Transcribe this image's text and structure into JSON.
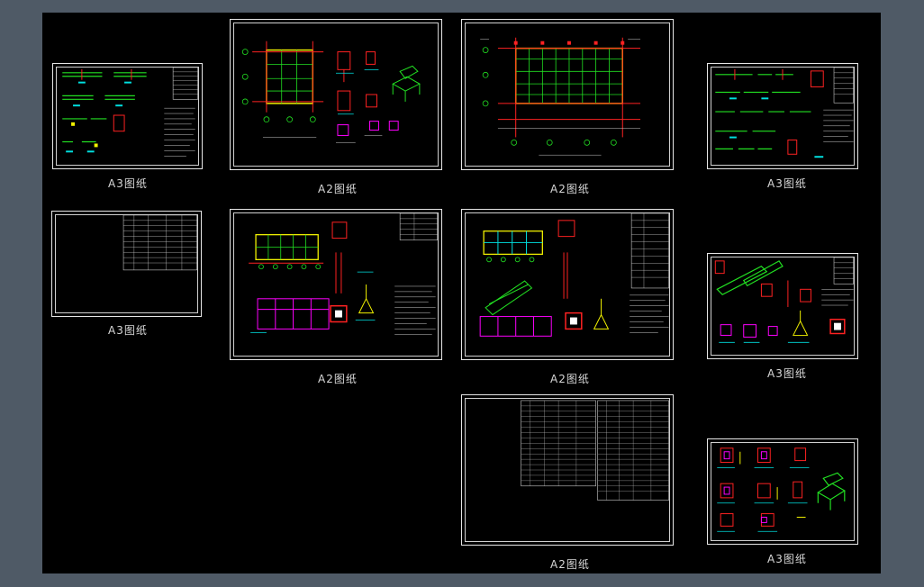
{
  "viewport": {
    "background": "#4f5a66",
    "canvas": "#000000"
  },
  "sheets": [
    {
      "id": "s1",
      "label": "A3图纸"
    },
    {
      "id": "s2",
      "label": "A2图纸"
    },
    {
      "id": "s3",
      "label": "A2图纸"
    },
    {
      "id": "s4",
      "label": "A3图纸"
    },
    {
      "id": "s5",
      "label": "A3图纸"
    },
    {
      "id": "s6",
      "label": "A2图纸"
    },
    {
      "id": "s7",
      "label": "A2图纸"
    },
    {
      "id": "s8",
      "label": "A3图纸"
    },
    {
      "id": "s9",
      "label": "A2图纸"
    },
    {
      "id": "s10",
      "label": "A3图纸"
    }
  ],
  "colors": {
    "line": "#e6e6e6",
    "green": "#22e022",
    "yellow": "#f2f200",
    "red": "#ff2222",
    "cyan": "#00e0e0",
    "magenta": "#ff00ff"
  }
}
